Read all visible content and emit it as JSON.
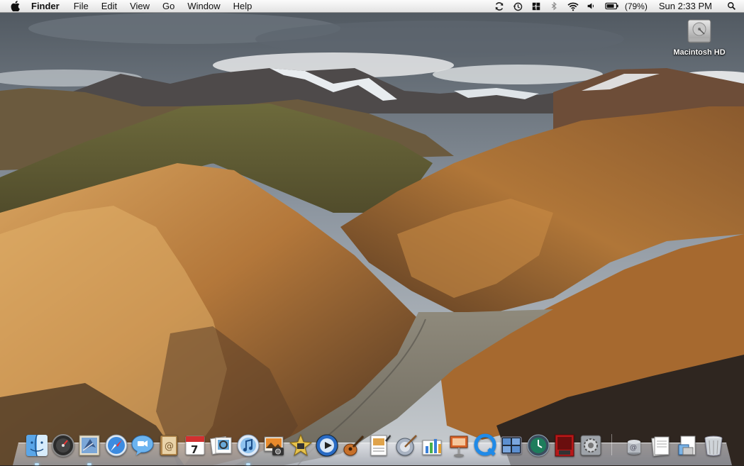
{
  "menubar": {
    "apple_icon": "apple-icon",
    "app_name": "Finder",
    "menus": [
      "File",
      "Edit",
      "View",
      "Go",
      "Window",
      "Help"
    ],
    "status_icons": [
      "sync-icon",
      "time-machine-icon",
      "spaces-icon",
      "bluetooth-icon",
      "wifi-icon",
      "volume-icon",
      "battery-icon"
    ],
    "battery_percent": "(79%)",
    "clock": "Sun 2:33 PM",
    "spotlight_icon": "spotlight-search-icon"
  },
  "desktop": {
    "icons": [
      {
        "label": "Macintosh HD",
        "icon": "hard-drive-icon"
      }
    ]
  },
  "dock": {
    "apps": [
      "finder",
      "dashboard",
      "mail",
      "safari",
      "ichat",
      "address-book",
      "ical",
      "preview",
      "itunes",
      "iphoto",
      "imovie",
      "dvd-player",
      "garageband",
      "iwork-pages",
      "script-editor",
      "numbers",
      "keynote",
      "quicktime",
      "spaces",
      "time-machine",
      "photo-booth",
      "system-preferences"
    ],
    "calendar_day": "7",
    "stacks": [
      "downloads-stack",
      "documents-stack",
      "applications-stack",
      "trash"
    ]
  },
  "colors": {
    "menubar_top": "#fbfbfb",
    "menubar_bottom": "#e3e3e3",
    "sky": "#8a939c",
    "rock_orange": "#b27a3a"
  }
}
